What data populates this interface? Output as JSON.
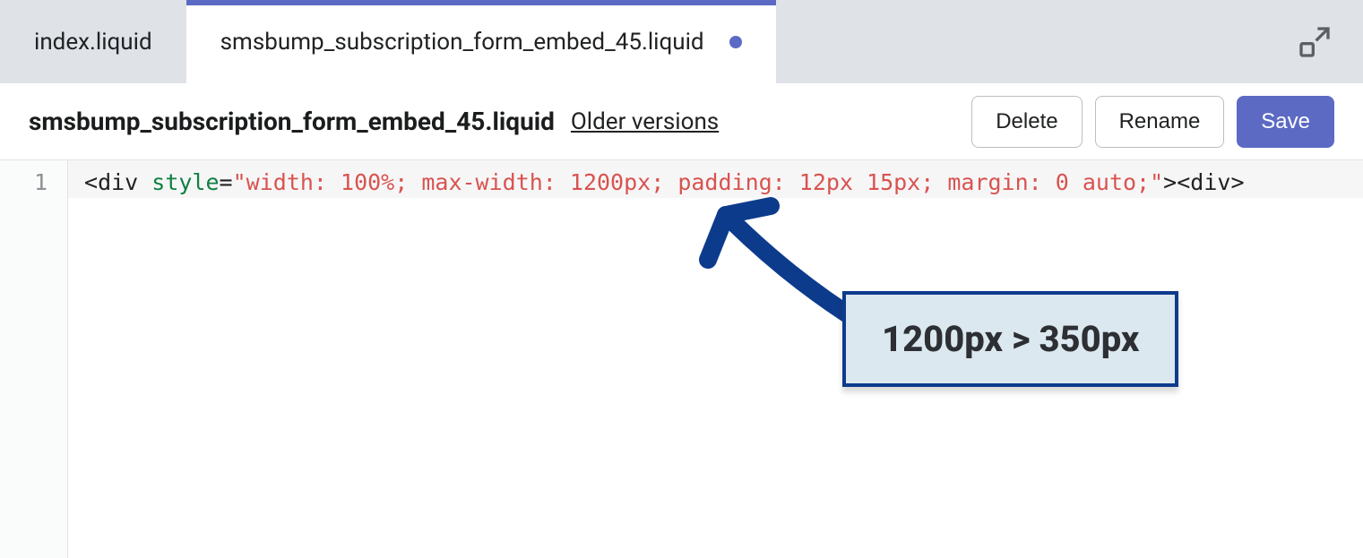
{
  "tabs": [
    {
      "label": "index.liquid",
      "active": false,
      "dirty": false
    },
    {
      "label": "smsbump_subscription_form_embed_45.liquid",
      "active": true,
      "dirty": true
    }
  ],
  "toolbar": {
    "file_title": "smsbump_subscription_form_embed_45.liquid",
    "older_versions_label": "Older versions",
    "delete_label": "Delete",
    "rename_label": "Rename",
    "save_label": "Save"
  },
  "editor": {
    "line_number": "1",
    "code": {
      "open_bracket": "<",
      "tag1": "div",
      "space1": " ",
      "attr": "style",
      "eq": "=",
      "quote_open": "\"",
      "style_value": "width: 100%; max-width: 1200px; padding: 12px 15px; margin: 0 auto;",
      "quote_close": "\"",
      "close_bracket": ">",
      "open_bracket2": "<",
      "tag2": "div",
      "close_bracket2": ">"
    }
  },
  "annotation": {
    "text": "1200px > 350px"
  },
  "colors": {
    "accent": "#5c6ac4",
    "annotation_border": "#0d3b8c",
    "annotation_bg": "#dce8ef"
  }
}
